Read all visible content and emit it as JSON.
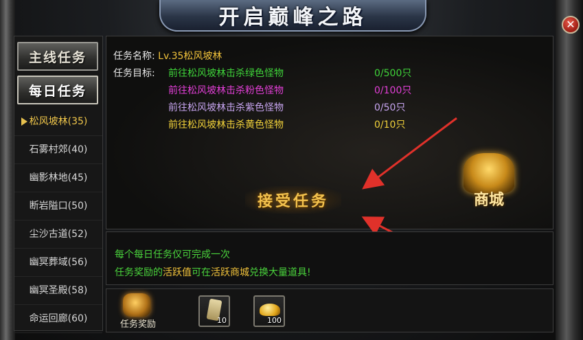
{
  "window": {
    "title": "开启巅峰之路",
    "close_glyph": "✕"
  },
  "sidebar": {
    "main_quest_label": "主线任务",
    "daily_quest_label": "每日任务",
    "zones": [
      {
        "label": "松风坡林(35)",
        "active": true
      },
      {
        "label": "石雾村郊(40)",
        "active": false
      },
      {
        "label": "幽影林地(45)",
        "active": false
      },
      {
        "label": "断岩隘口(50)",
        "active": false
      },
      {
        "label": "尘沙古道(52)",
        "active": false
      },
      {
        "label": "幽冥葬域(56)",
        "active": false
      },
      {
        "label": "幽冥圣殿(58)",
        "active": false
      },
      {
        "label": "命运回廊(60)",
        "active": false
      }
    ]
  },
  "task": {
    "name_label": "任务名称:",
    "name_value": "Lv.35松风坡林",
    "objective_label": "任务目标:",
    "objectives": [
      {
        "text": "前往松风坡林击杀绿色怪物",
        "count": "0/500只",
        "color": "#3fd43a"
      },
      {
        "text": "前往松风坡林击杀粉色怪物",
        "count": "0/100只",
        "color": "#e43fd8"
      },
      {
        "text": "前往松风坡林击杀紫色怪物",
        "count": "0/50只",
        "color": "#c7a5f0"
      },
      {
        "text": "前往松风坡林击杀黄色怪物",
        "count": "0/10只",
        "color": "#f2d23a"
      }
    ],
    "accept_label": "接受任务",
    "shop_label": "商城"
  },
  "notes": {
    "line1": "每个每日任务仅可完成一次",
    "line2_a": "任务奖励的",
    "line2_b": "活跃值",
    "line2_c": "可在",
    "line2_d": "活跃商城",
    "line2_e": "兑换大量道具!"
  },
  "rewards": {
    "label": "任务奖励",
    "items": [
      {
        "icon": "scroll-icon",
        "qty": "10"
      },
      {
        "icon": "gold-ingot-icon",
        "qty": "100"
      }
    ]
  },
  "colors": {
    "accent_gold": "#f2c33b",
    "note_green": "#4ad33c",
    "arrow_red": "#e0312a"
  }
}
